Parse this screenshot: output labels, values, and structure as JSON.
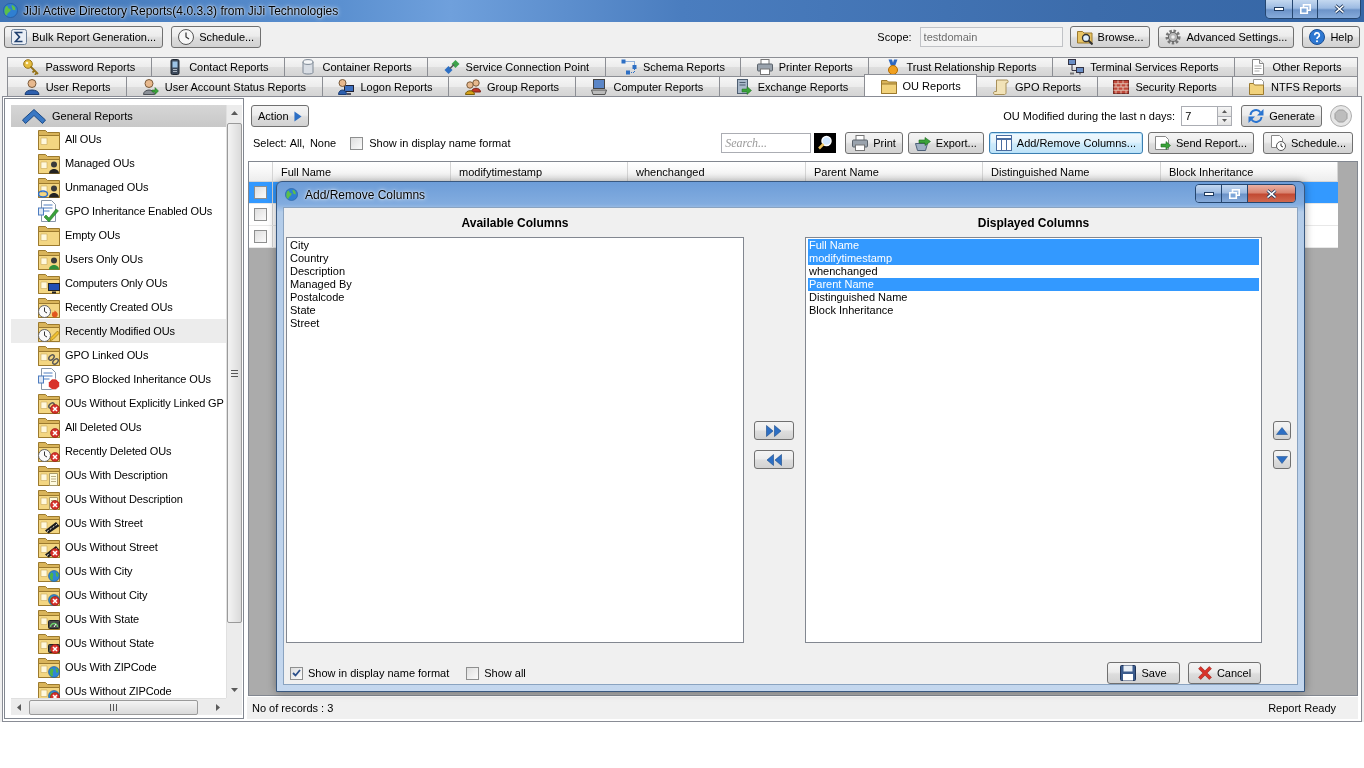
{
  "window": {
    "title": "JiJi Active Directory Reports(4.0.3.3) from JiJi Technologies"
  },
  "toolbar": {
    "left_buttons": [
      "Bulk Report Generation...",
      "Schedule..."
    ],
    "scope": {
      "label": "Scope:",
      "value": "testdomain",
      "disabled": true
    },
    "right_buttons": [
      "Browse...",
      "Advanced Settings...",
      "Help"
    ]
  },
  "tab_rows": [
    {
      "tabs": [
        {
          "label": "Password Reports",
          "selected": false
        },
        {
          "label": "Contact Reports",
          "selected": false
        },
        {
          "label": "Container Reports",
          "selected": false
        },
        {
          "label": "Service Connection Point",
          "selected": false
        },
        {
          "label": "Schema Reports",
          "selected": false
        },
        {
          "label": "Printer Reports",
          "selected": false
        },
        {
          "label": "Trust Relationship Reports",
          "selected": false
        },
        {
          "label": "Terminal Services Reports",
          "selected": false
        },
        {
          "label": "Other Reports",
          "selected": false
        }
      ]
    },
    {
      "tabs": [
        {
          "label": "User Reports",
          "selected": false
        },
        {
          "label": "User Account Status Reports",
          "selected": false
        },
        {
          "label": "Logon Reports",
          "selected": false
        },
        {
          "label": "Group Reports",
          "selected": false
        },
        {
          "label": "Computer Reports",
          "selected": false
        },
        {
          "label": "Exchange Reports",
          "selected": false
        },
        {
          "label": "OU Reports",
          "selected": true
        },
        {
          "label": "GPO Reports",
          "selected": false
        },
        {
          "label": "Security Reports",
          "selected": false
        },
        {
          "label": "NTFS Reports",
          "selected": false
        }
      ]
    }
  ],
  "sidebar": {
    "group": {
      "label": "General Reports",
      "expanded": true
    },
    "items": [
      {
        "label": "All OUs",
        "selected": false
      },
      {
        "label": "Managed OUs",
        "selected": false
      },
      {
        "label": "Unmanaged OUs",
        "selected": false
      },
      {
        "label": "GPO Inheritance Enabled OUs",
        "selected": false
      },
      {
        "label": "Empty OUs",
        "selected": false
      },
      {
        "label": "Users Only OUs",
        "selected": false
      },
      {
        "label": "Computers Only OUs",
        "selected": false
      },
      {
        "label": "Recently Created OUs",
        "selected": false
      },
      {
        "label": "Recently Modified OUs",
        "selected": true
      },
      {
        "label": "GPO Linked OUs",
        "selected": false
      },
      {
        "label": "GPO Blocked Inheritance OUs",
        "selected": false
      },
      {
        "label": "OUs Without Explicitly Linked GP",
        "selected": false
      },
      {
        "label": "All Deleted OUs",
        "selected": false
      },
      {
        "label": "Recently Deleted OUs",
        "selected": false
      },
      {
        "label": "OUs With Description",
        "selected": false
      },
      {
        "label": "OUs Without Description",
        "selected": false
      },
      {
        "label": "OUs With Street",
        "selected": false
      },
      {
        "label": "OUs Without Street",
        "selected": false
      },
      {
        "label": "OUs With City",
        "selected": false
      },
      {
        "label": "OUs Without City",
        "selected": false
      },
      {
        "label": "OUs With State",
        "selected": false
      },
      {
        "label": "OUs Without State",
        "selected": false
      },
      {
        "label": "OUs With ZIPCode",
        "selected": false
      },
      {
        "label": "OUs Without ZIPCode",
        "selected": false
      }
    ]
  },
  "report": {
    "action_button": "Action",
    "period": {
      "label": "OU Modified during the last n days:",
      "value": "7"
    },
    "generate_button": "Generate",
    "stop_button": {
      "disabled": true
    },
    "select": {
      "label": "Select:",
      "links": [
        "All,",
        "None"
      ]
    },
    "display_name_format": {
      "label": "Show in display name format",
      "checked": false
    },
    "search": {
      "placeholder": "Search..."
    },
    "buttons": [
      {
        "label": "Print",
        "focused": false
      },
      {
        "label": "Export...",
        "focused": false
      },
      {
        "label": "Add/Remove Columns...",
        "focused": true
      },
      {
        "label": "Send Report...",
        "focused": false
      },
      {
        "label": "Schedule...",
        "focused": false
      }
    ],
    "table": {
      "columns": [
        "Full Name",
        "modifytimestamp",
        "whenchanged",
        "Parent Name",
        "Distinguished Name",
        "Block Inheritance"
      ],
      "rows": [
        {
          "selected": true,
          "checked": false
        },
        {
          "selected": false,
          "checked": false
        },
        {
          "selected": false,
          "checked": false
        }
      ]
    },
    "status_bar": {
      "records": "No of records : 3",
      "state": "Report Ready"
    }
  },
  "dialog": {
    "title": "Add/Remove Columns",
    "available": {
      "heading": "Available Columns",
      "items": [
        {
          "label": "City",
          "selected": false
        },
        {
          "label": "Country",
          "selected": false
        },
        {
          "label": "Description",
          "selected": false
        },
        {
          "label": "Managed By",
          "selected": false
        },
        {
          "label": "Postalcode",
          "selected": false
        },
        {
          "label": "State",
          "selected": false
        },
        {
          "label": "Street",
          "selected": false
        }
      ]
    },
    "displayed": {
      "heading": "Displayed Columns",
      "items": [
        {
          "label": "Full Name",
          "selected": true
        },
        {
          "label": "modifytimestamp",
          "selected": true
        },
        {
          "label": "whenchanged",
          "selected": false
        },
        {
          "label": "Parent Name",
          "selected": true
        },
        {
          "label": "Distinguished Name",
          "selected": false
        },
        {
          "label": "Block Inheritance",
          "selected": false
        }
      ]
    },
    "options": [
      {
        "label": "Show in display name format",
        "checked": true
      },
      {
        "label": "Show all",
        "checked": false
      }
    ],
    "buttons": [
      "Save",
      "Cancel"
    ]
  }
}
